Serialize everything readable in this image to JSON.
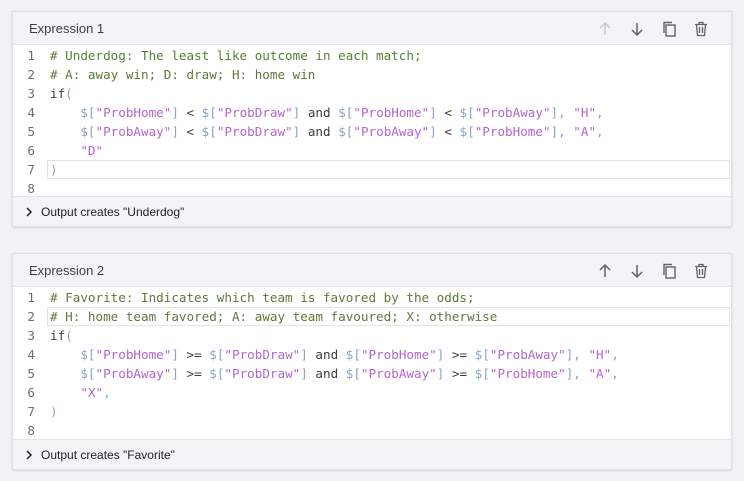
{
  "expression1": {
    "title": "Expression 1",
    "output_label": "Output creates \"Underdog\"",
    "move_up_disabled": true,
    "line_numbers": [
      "1",
      "2",
      "3",
      "4",
      "5",
      "6",
      "7",
      "8"
    ],
    "lines": [
      [
        {
          "t": "# Underdog: The least like outcome in each match;",
          "c": "cm"
        }
      ],
      [
        {
          "t": "# A: away win; D: draw; H: home win",
          "c": "cm"
        }
      ],
      [
        {
          "t": "if",
          "c": "fn"
        },
        {
          "t": "(",
          "c": "pn"
        }
      ],
      [
        {
          "t": "    $[",
          "c": "pn"
        },
        {
          "t": "\"ProbHome\"",
          "c": "str"
        },
        {
          "t": "] ",
          "c": "pn"
        },
        {
          "t": "< ",
          "c": "op"
        },
        {
          "t": "$[",
          "c": "pn"
        },
        {
          "t": "\"ProbDraw\"",
          "c": "str"
        },
        {
          "t": "] ",
          "c": "pn"
        },
        {
          "t": "and ",
          "c": "kw"
        },
        {
          "t": "$[",
          "c": "pn"
        },
        {
          "t": "\"ProbHome\"",
          "c": "str"
        },
        {
          "t": "] ",
          "c": "pn"
        },
        {
          "t": "< ",
          "c": "op"
        },
        {
          "t": "$[",
          "c": "pn"
        },
        {
          "t": "\"ProbAway\"",
          "c": "str"
        },
        {
          "t": "], ",
          "c": "pn"
        },
        {
          "t": "\"H\"",
          "c": "str"
        },
        {
          "t": ",",
          "c": "pn"
        }
      ],
      [
        {
          "t": "    $[",
          "c": "pn"
        },
        {
          "t": "\"ProbAway\"",
          "c": "str"
        },
        {
          "t": "] ",
          "c": "pn"
        },
        {
          "t": "< ",
          "c": "op"
        },
        {
          "t": "$[",
          "c": "pn"
        },
        {
          "t": "\"ProbDraw\"",
          "c": "str"
        },
        {
          "t": "] ",
          "c": "pn"
        },
        {
          "t": "and ",
          "c": "kw"
        },
        {
          "t": "$[",
          "c": "pn"
        },
        {
          "t": "\"ProbAway\"",
          "c": "str"
        },
        {
          "t": "] ",
          "c": "pn"
        },
        {
          "t": "< ",
          "c": "op"
        },
        {
          "t": "$[",
          "c": "pn"
        },
        {
          "t": "\"ProbHome\"",
          "c": "str"
        },
        {
          "t": "], ",
          "c": "pn"
        },
        {
          "t": "\"A\"",
          "c": "str"
        },
        {
          "t": ",",
          "c": "pn"
        }
      ],
      [
        {
          "t": "    \"D\"",
          "c": "str"
        }
      ],
      [
        {
          "t": ")",
          "c": "pn"
        }
      ],
      []
    ],
    "active_line": 7
  },
  "expression2": {
    "title": "Expression 2",
    "output_label": "Output creates \"Favorite\"",
    "move_up_disabled": false,
    "line_numbers": [
      "1",
      "2",
      "3",
      "4",
      "5",
      "6",
      "7",
      "8"
    ],
    "lines": [
      [
        {
          "t": "# Favorite: Indicates which team is favored by the odds;",
          "c": "cm"
        }
      ],
      [
        {
          "t": "# H: home team favored; A: away team favoured; X: otherwise",
          "c": "cm"
        }
      ],
      [
        {
          "t": "if",
          "c": "fn"
        },
        {
          "t": "(",
          "c": "pn"
        }
      ],
      [
        {
          "t": "    $[",
          "c": "pn"
        },
        {
          "t": "\"ProbHome\"",
          "c": "str"
        },
        {
          "t": "] ",
          "c": "pn"
        },
        {
          "t": ">= ",
          "c": "op"
        },
        {
          "t": "$[",
          "c": "pn"
        },
        {
          "t": "\"ProbDraw\"",
          "c": "str"
        },
        {
          "t": "] ",
          "c": "pn"
        },
        {
          "t": "and ",
          "c": "kw"
        },
        {
          "t": "$[",
          "c": "pn"
        },
        {
          "t": "\"ProbHome\"",
          "c": "str"
        },
        {
          "t": "] ",
          "c": "pn"
        },
        {
          "t": ">= ",
          "c": "op"
        },
        {
          "t": "$[",
          "c": "pn"
        },
        {
          "t": "\"ProbAway\"",
          "c": "str"
        },
        {
          "t": "], ",
          "c": "pn"
        },
        {
          "t": "\"H\"",
          "c": "str"
        },
        {
          "t": ",",
          "c": "pn"
        }
      ],
      [
        {
          "t": "    $[",
          "c": "pn"
        },
        {
          "t": "\"ProbAway\"",
          "c": "str"
        },
        {
          "t": "] ",
          "c": "pn"
        },
        {
          "t": ">= ",
          "c": "op"
        },
        {
          "t": "$[",
          "c": "pn"
        },
        {
          "t": "\"ProbDraw\"",
          "c": "str"
        },
        {
          "t": "] ",
          "c": "pn"
        },
        {
          "t": "and ",
          "c": "kw"
        },
        {
          "t": "$[",
          "c": "pn"
        },
        {
          "t": "\"ProbAway\"",
          "c": "str"
        },
        {
          "t": "] ",
          "c": "pn"
        },
        {
          "t": ">= ",
          "c": "op"
        },
        {
          "t": "$[",
          "c": "pn"
        },
        {
          "t": "\"ProbHome\"",
          "c": "str"
        },
        {
          "t": "], ",
          "c": "pn"
        },
        {
          "t": "\"A\"",
          "c": "str"
        },
        {
          "t": ",",
          "c": "pn"
        }
      ],
      [
        {
          "t": "    \"X\"",
          "c": "str"
        },
        {
          "t": ",",
          "c": "pn"
        }
      ],
      [
        {
          "t": ")",
          "c": "pn"
        }
      ],
      []
    ],
    "active_line": 2
  },
  "icons": {
    "move_up": "arrow-up-icon",
    "move_down": "arrow-down-icon",
    "copy": "copy-icon",
    "delete": "trash-icon",
    "expand": "chevron-right-icon"
  },
  "colors": {
    "comment": "#5b7a3a",
    "string": "#b464cf",
    "punctuation": "#8aa3c7",
    "icon": "#5f6368",
    "icon_disabled": "#bdc1c6"
  }
}
